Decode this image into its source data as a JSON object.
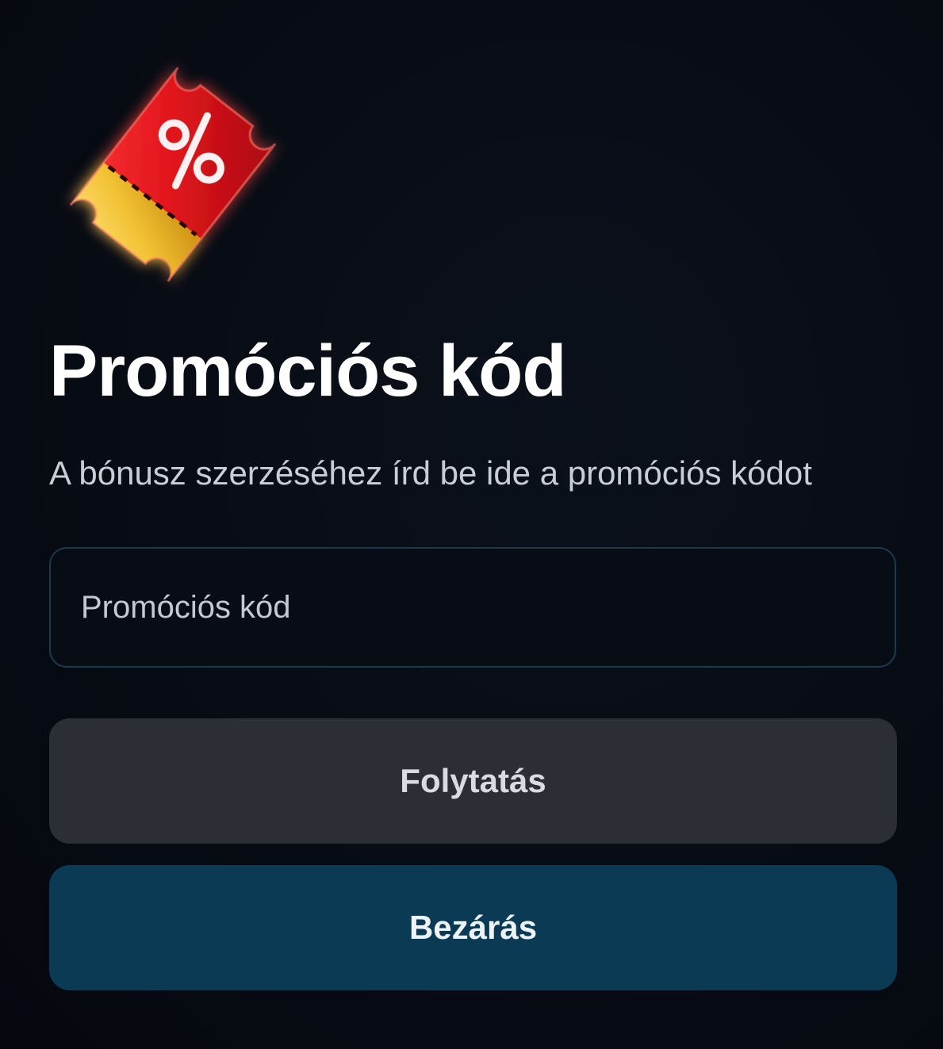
{
  "promo": {
    "title": "Promóciós kód",
    "subtitle": "A bónusz szerzéséhez írd be ide a promóciós kódot",
    "input": {
      "value": "",
      "placeholder": "Promóciós kód"
    },
    "continue_label": "Folytatás",
    "close_label": "Bezárás",
    "icon": "percent-ticket-icon"
  },
  "colors": {
    "background": "#060a12",
    "input_border": "#1c3a4c",
    "continue_button": "#2c2e35",
    "close_button": "#0a3a54",
    "ticket_red": "#e0151c",
    "ticket_gold": "#f2c233"
  }
}
